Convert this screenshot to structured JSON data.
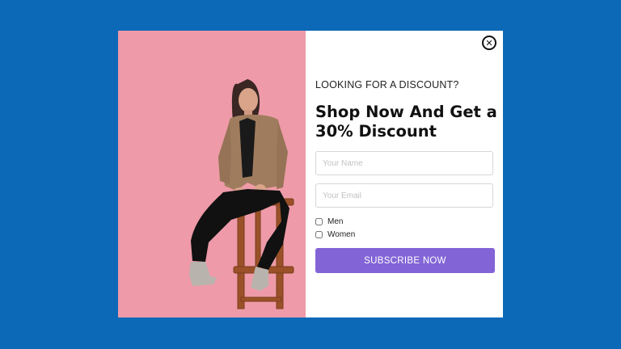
{
  "popup": {
    "eyebrow": "LOOKING FOR A DISCOUNT?",
    "headline": "Shop Now And Get a 30% Discount",
    "close_icon": "close-circle-icon",
    "name_placeholder": "Your Name",
    "email_placeholder": "Your Email",
    "options": [
      {
        "label": "Men",
        "checked": false
      },
      {
        "label": "Women",
        "checked": false
      }
    ],
    "subscribe_label": "SUBSCRIBE NOW"
  },
  "colors": {
    "page_background": "#0b69b7",
    "photo_background": "#ee9aa8",
    "button": "#8264d6"
  }
}
